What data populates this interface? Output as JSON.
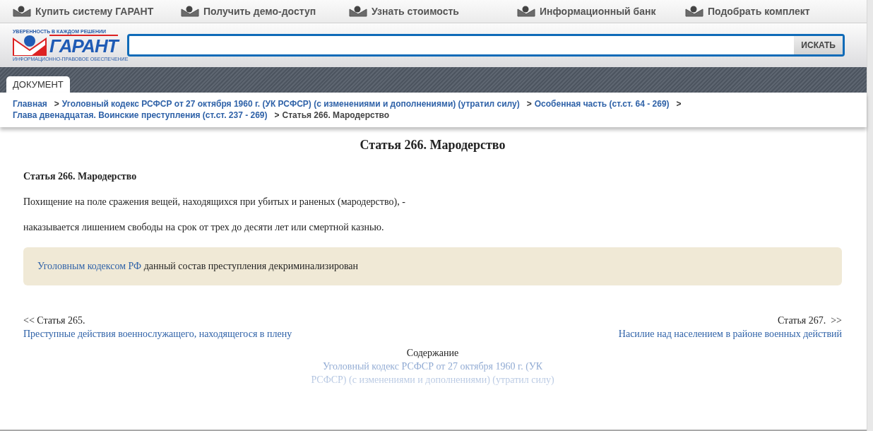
{
  "top_nav": [
    {
      "label": "Купить систему ГАРАНТ"
    },
    {
      "label": "Получить демо-доступ"
    },
    {
      "label": "Узнать стоимость"
    },
    {
      "label": "Информационный банк"
    },
    {
      "label": "Подобрать комплект"
    }
  ],
  "logo": {
    "tagline": "УВЕРЕННОСТЬ В КАЖДОМ РЕШЕНИИ",
    "name": "ГАРАНТ",
    "subtitle": "ИНФОРМАЦИОННО-ПРАВОВОЕ ОБЕСПЕЧЕНИЕ"
  },
  "search": {
    "button": "ИСКАТЬ"
  },
  "tabs": [
    {
      "label": "ДОКУМЕНТ",
      "selected": true
    }
  ],
  "breadcrumbs": [
    {
      "kind": "link",
      "label": "Главная"
    },
    {
      "kind": "link",
      "separator": ">",
      "label": "Уголовный кодекс РСФСР от 27 октября 1960 г. (УК РСФСР) (с изменениями и дополнениями) (утратил силу)"
    },
    {
      "kind": "link",
      "separator": ">",
      "label": "Особенная часть (ст.ст. 64 - 269)"
    },
    {
      "kind": "link",
      "separator": ">",
      "label": "Глава двенадцатая. Воинские преступления (ст.ст. 237 - 269)"
    },
    {
      "kind": "current",
      "separator": ">",
      "label": "Статья 266. Мародерство"
    }
  ],
  "document": {
    "title": "Статья 266. Мародерство",
    "heading": "Статья 266. Мародерство",
    "paragraphs": [
      "Похищение на поле сражения вещей, находящихся при убитых и раненых (мародерство), -",
      "наказывается лишением свободы на срок от трех до десяти лет или смертной казнью."
    ],
    "note": {
      "link": "Уголовным кодексом РФ",
      "text": " данный состав преступления декриминализирован"
    }
  },
  "prev": {
    "label": "<< Статья 265.",
    "link": "Преступные действия военнослужащего, находящегося в плену"
  },
  "next": {
    "label": "Статья 267.  >>",
    "link": "Насилие над населением в районе военных действий"
  },
  "contents": {
    "label": "Содержание",
    "link": "Уголовный кодекс РСФСР от 27 октября 1960 г. (УК РСФСР) (с изменениями и дополнениями) (утратил силу)"
  }
}
